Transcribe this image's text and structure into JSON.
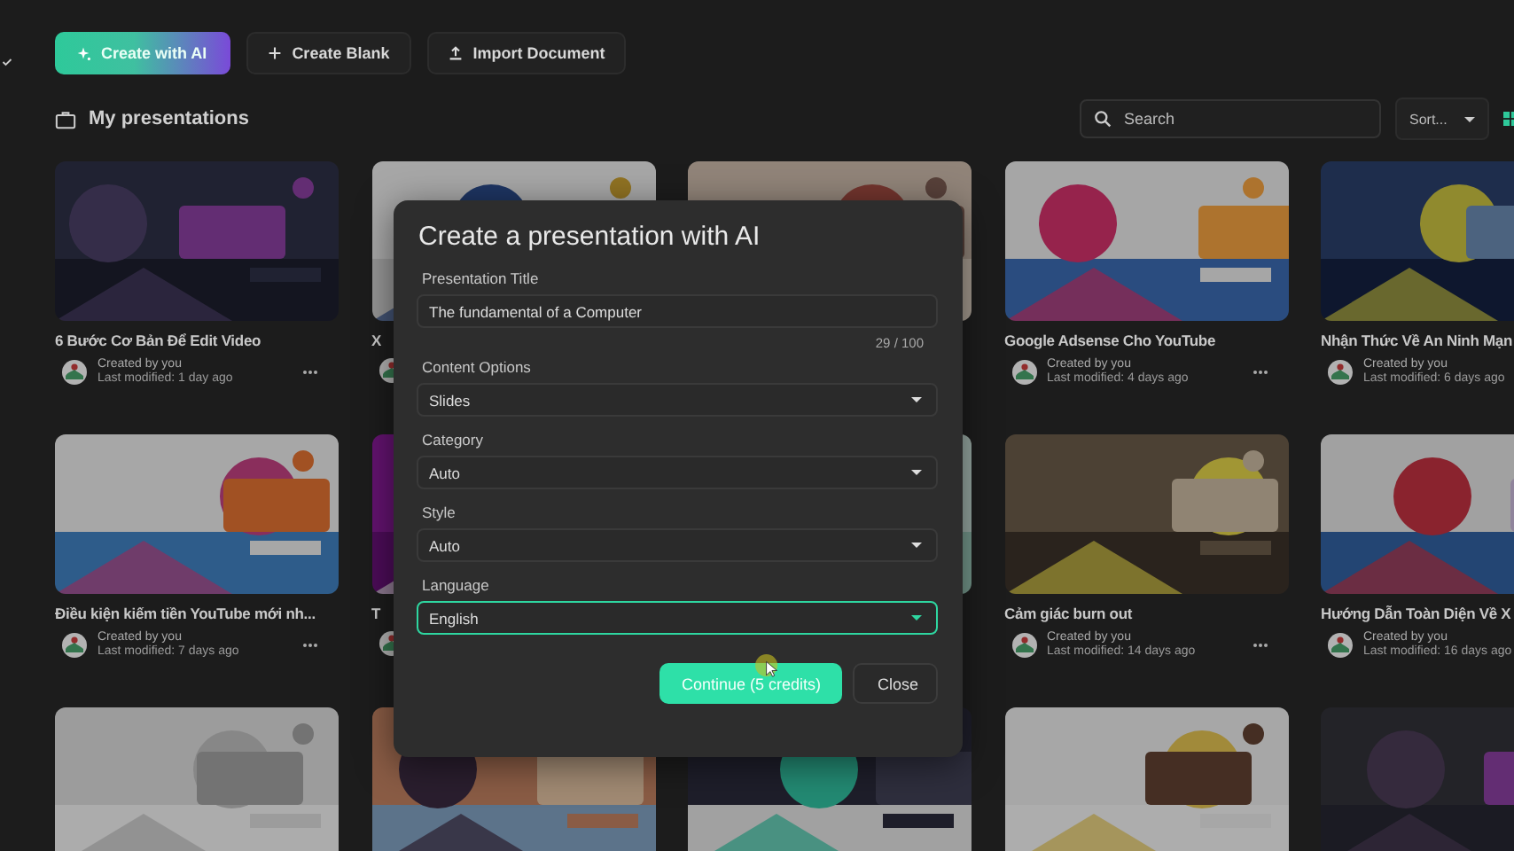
{
  "toolbar": {
    "buttons": [
      {
        "label": "Create with AI",
        "kind": "ai"
      },
      {
        "label": "Create Blank",
        "kind": "blank"
      },
      {
        "label": "Import Document",
        "kind": "import"
      }
    ]
  },
  "section": {
    "title": "My presentations"
  },
  "search": {
    "placeholder": "Search"
  },
  "sort": {
    "label": "Sort..."
  },
  "cards": [
    {
      "kind": "picture",
      "title": "6 Bước Cơ Bản Để Edit Video",
      "created": "Created by you",
      "modified": "Last modified: 1 day ago",
      "menu": true
    },
    {
      "kind": "picture",
      "title": "X",
      "avatar": true
    },
    {
      "kind": "picture"
    },
    {
      "kind": "picture",
      "title": "Google Adsense Cho YouTube",
      "created": "Created by you",
      "modified": "Last modified: 4 days ago",
      "menu": true
    },
    {
      "kind": "picture",
      "title": "Nhận Thức Về An Ninh Mạn",
      "created": "Created by you",
      "modified": "Last modified: 6 days ago",
      "menu": false
    },
    {
      "kind": "picture",
      "title": "Điều kiện kiếm tiền YouTube mới nh...",
      "created": "Created by you",
      "modified": "Last modified: 7 days ago",
      "menu": true
    },
    {
      "kind": "picture",
      "title": "T",
      "avatar": true
    },
    {
      "kind": "picture"
    },
    {
      "kind": "picture",
      "title": "Cảm giác burn out",
      "created": "Created by you",
      "modified": "Last modified: 14 days ago",
      "menu": true
    },
    {
      "kind": "picture",
      "title": "Hướng Dẫn Toàn Diện Về X",
      "created": "Created by you",
      "modified": "Last modified: 16 days ago",
      "menu": false
    },
    {
      "kind": "picture"
    },
    {
      "kind": "picture"
    },
    {
      "kind": "picture"
    },
    {
      "kind": "picture"
    },
    {
      "kind": "picture"
    }
  ],
  "dialog": {
    "title": "Create a presentation with AI",
    "fields": [
      {
        "label": "Presentation Title",
        "kind": "text",
        "value": "The fundamental of a Computer",
        "counter": "29 / 100",
        "focused": false
      },
      {
        "label": "Content Options",
        "kind": "select",
        "value": "Slides",
        "focused": false
      },
      {
        "label": "Category",
        "kind": "select",
        "value": "Auto",
        "focused": false
      },
      {
        "label": "Style",
        "kind": "select",
        "value": "Auto",
        "focused": false
      },
      {
        "label": "Language",
        "kind": "select",
        "value": "English",
        "focused": true
      }
    ],
    "buttons": [
      {
        "label": "Continue (5 credits)",
        "kind": "primary"
      },
      {
        "label": "Close",
        "kind": "secondary"
      }
    ]
  }
}
